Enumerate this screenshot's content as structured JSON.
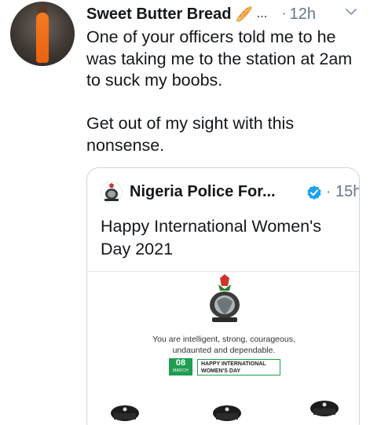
{
  "tweet": {
    "author_name": "Sweet Butter Bread",
    "name_emoji": "🥖",
    "name_ellipsis": "...",
    "separator": "·",
    "time": "12h",
    "text": "One of your officers told me to he was taking me to the station at 2am to suck my boobs.\n\nGet out of my sight with this nonsense."
  },
  "quoted_tweet": {
    "author_name": "Nigeria Police For...",
    "separator": "·",
    "time": "15h",
    "text": "Happy International Women's Day 2021",
    "image": {
      "line1": "You are intelligent, strong, courageous,",
      "line2": "undaunted and dependable.",
      "date_number": "08",
      "date_month": "MARCH",
      "banner_line1": "HAPPY INTERNATIONAL",
      "banner_line2": "WOMEN'S DAY"
    }
  },
  "colors": {
    "verified_badge": "#1da1f2",
    "muted_text": "#657786",
    "date_green": "#1f9d52"
  },
  "icons": {
    "more_menu": "chevron-down-icon",
    "verified": "verified-badge-icon"
  }
}
